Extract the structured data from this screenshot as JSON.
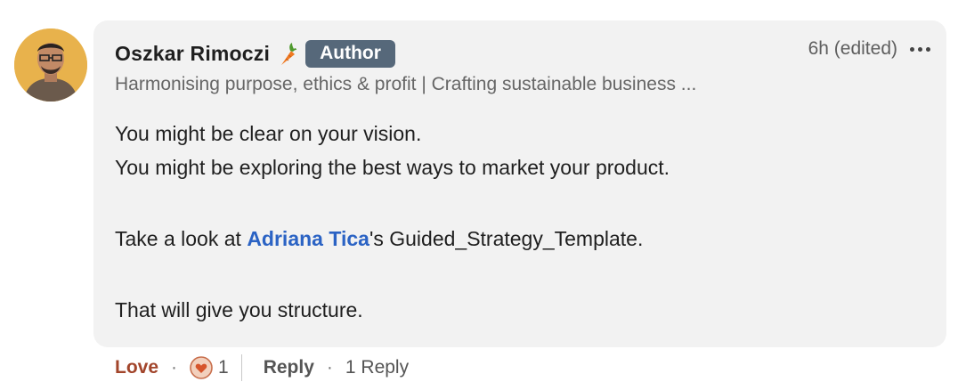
{
  "author": {
    "name": "Oszkar Rimoczi",
    "badge": "Author",
    "headline": "Harmonising purpose, ethics & profit | Crafting sustainable business ...",
    "emoji_icon": "carrot-icon"
  },
  "meta": {
    "timestamp": "6h (edited)",
    "more_icon": "more-options-icon"
  },
  "comment": {
    "line1": "You might be clear on your vision.",
    "line2": "You might be exploring the best ways to market your product.",
    "line3_prefix": "Take a look at ",
    "mention": "Adriana Tica",
    "line3_suffix": "'s Guided_Strategy_Template.",
    "line4": "That will give you structure."
  },
  "actions": {
    "reaction_label": "Love",
    "separator": "·",
    "reaction_count": "1",
    "reply_label": "Reply",
    "replies_text": "1 Reply"
  },
  "colors": {
    "bubble": "#f2f2f2",
    "badge": "#56687a",
    "mention": "#2b63c4",
    "love": "#a2452b"
  }
}
